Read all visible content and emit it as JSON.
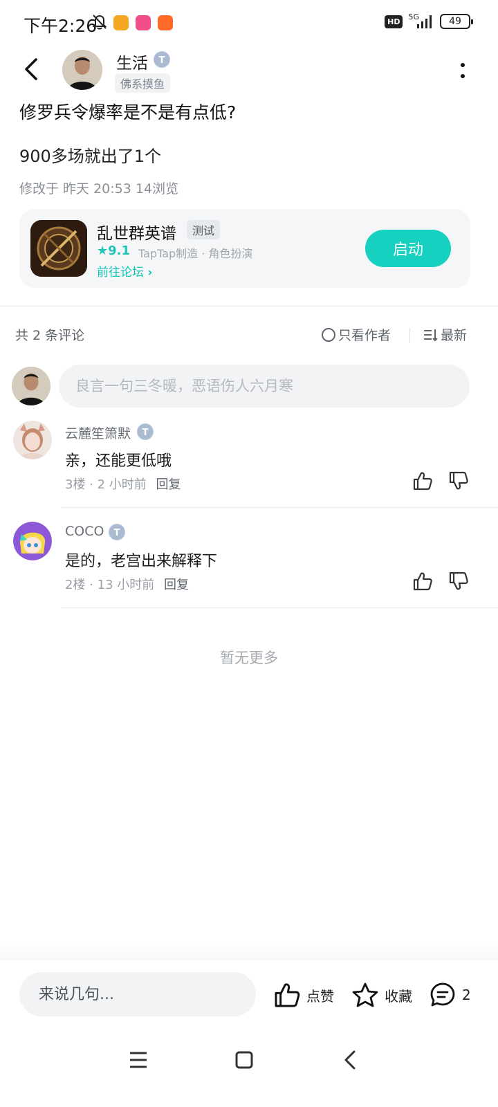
{
  "status_bar": {
    "time": "下午2:26",
    "network": "5G",
    "hd": "HD",
    "battery": "49"
  },
  "header": {
    "author_name": "生活",
    "author_tag": "佛系摸鱼"
  },
  "post": {
    "title": "修罗兵令爆率是不是有点低?",
    "body": "900多场就出了1个",
    "meta": "修改于 昨天 20:53  14浏览"
  },
  "game_card": {
    "name": "乱世群英谱",
    "tag": "测试",
    "rating": "9.1",
    "maker": "TapTap制造 · 角色扮演",
    "forum_link": "前往论坛",
    "launch_label": "启动",
    "accent": "#17d1c0"
  },
  "comments_header": {
    "count_label": "共 2 条评论",
    "only_author_label": "只看作者",
    "sort_label": "最新"
  },
  "comment_input": {
    "placeholder": "良言一句三冬暖，恶语伤人六月寒"
  },
  "comments": [
    {
      "name": "云麓笙箫默",
      "text": "亲，还能更低哦",
      "floor": "3楼",
      "time": "2 小时前",
      "reply_label": "回复"
    },
    {
      "name": "COCO",
      "text": "是的，老宫出来解释下",
      "floor": "2楼",
      "time": "13 小时前",
      "reply_label": "回复"
    }
  ],
  "no_more": "暂无更多",
  "bottom_bar": {
    "placeholder": "来说几句...",
    "like_label": "点赞",
    "favorite_label": "收藏",
    "comment_count": "2"
  }
}
